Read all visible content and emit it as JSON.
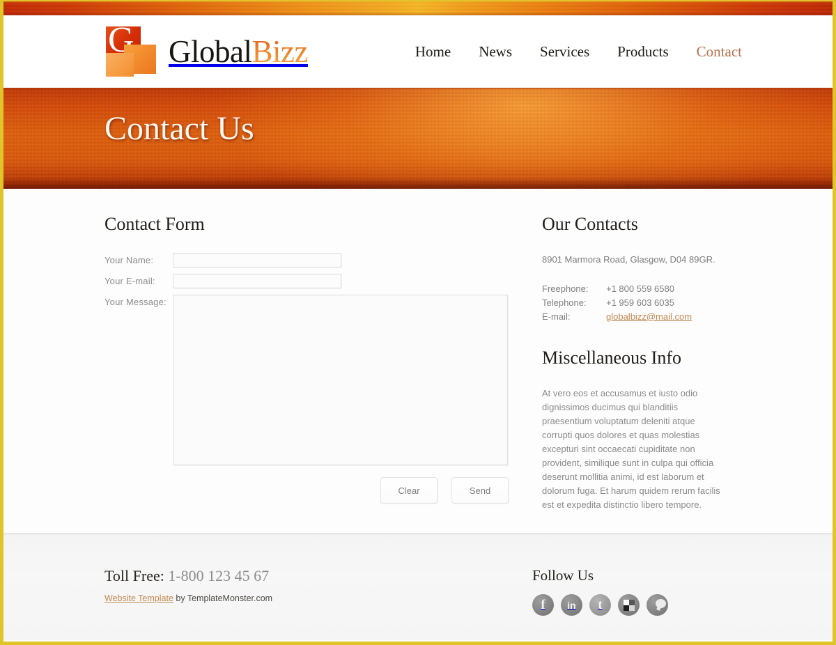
{
  "site": {
    "logo": {
      "letter": "G",
      "name_first": "Global",
      "name_second": "Bizz",
      "accent_color": "#e4581a"
    },
    "nav": [
      {
        "label": "Home",
        "active": false
      },
      {
        "label": "News",
        "active": false
      },
      {
        "label": "Services",
        "active": false
      },
      {
        "label": "Products",
        "active": false
      },
      {
        "label": "Contact",
        "active": true
      }
    ]
  },
  "banner": {
    "title": "Contact Us"
  },
  "form": {
    "heading": "Contact Form",
    "fields": {
      "name_label": "Your Name:",
      "name_value": "",
      "name_placeholder": "",
      "email_label": "Your E-mail:",
      "email_value": "",
      "email_placeholder": "",
      "message_label": "Your Message:",
      "message_value": "",
      "message_placeholder": ""
    },
    "buttons": {
      "clear": "Clear",
      "send": "Send"
    }
  },
  "contacts": {
    "heading": "Our Contacts",
    "address": "8901 Marmora Road, Glasgow, D04 89GR.",
    "rows": [
      {
        "key": "Freephone:",
        "value": "+1 800 559 6580",
        "is_link": false
      },
      {
        "key": "Telephone:",
        "value": "+1 959 603 6035",
        "is_link": false
      },
      {
        "key": "E-mail:",
        "value": "globalbizz@mail.com",
        "is_link": true
      }
    ]
  },
  "misc": {
    "heading": "Miscellaneous Info",
    "body": "At vero eos et accusamus et iusto odio dignissimos ducimus qui blanditiis praesentium voluptatum deleniti atque corrupti quos dolores et quas molestias excepturi sint occaecati cupiditate non provident, similique sunt in culpa qui officia deserunt mollitia animi, id est laborum et dolorum fuga. Et harum quidem rerum facilis est et expedita distinctio libero tempore."
  },
  "footer": {
    "toll_label": "Toll Free:",
    "toll_number": "1-800 123 45 67",
    "credit_link": "Website Template",
    "credit_rest": " by TemplateMonster.com",
    "watermark": "",
    "follow_title": "Follow Us",
    "social": [
      {
        "name": "facebook",
        "glyph": "f"
      },
      {
        "name": "linkedin",
        "glyph": "in"
      },
      {
        "name": "twitter",
        "glyph": "t"
      },
      {
        "name": "delicious",
        "glyph": ""
      },
      {
        "name": "chat",
        "glyph": ""
      }
    ]
  },
  "theme": {
    "border": "#e0c52a",
    "banner_orange": "#d64a09",
    "link_orange": "#c1884f",
    "nav_active": "#b9714f"
  }
}
